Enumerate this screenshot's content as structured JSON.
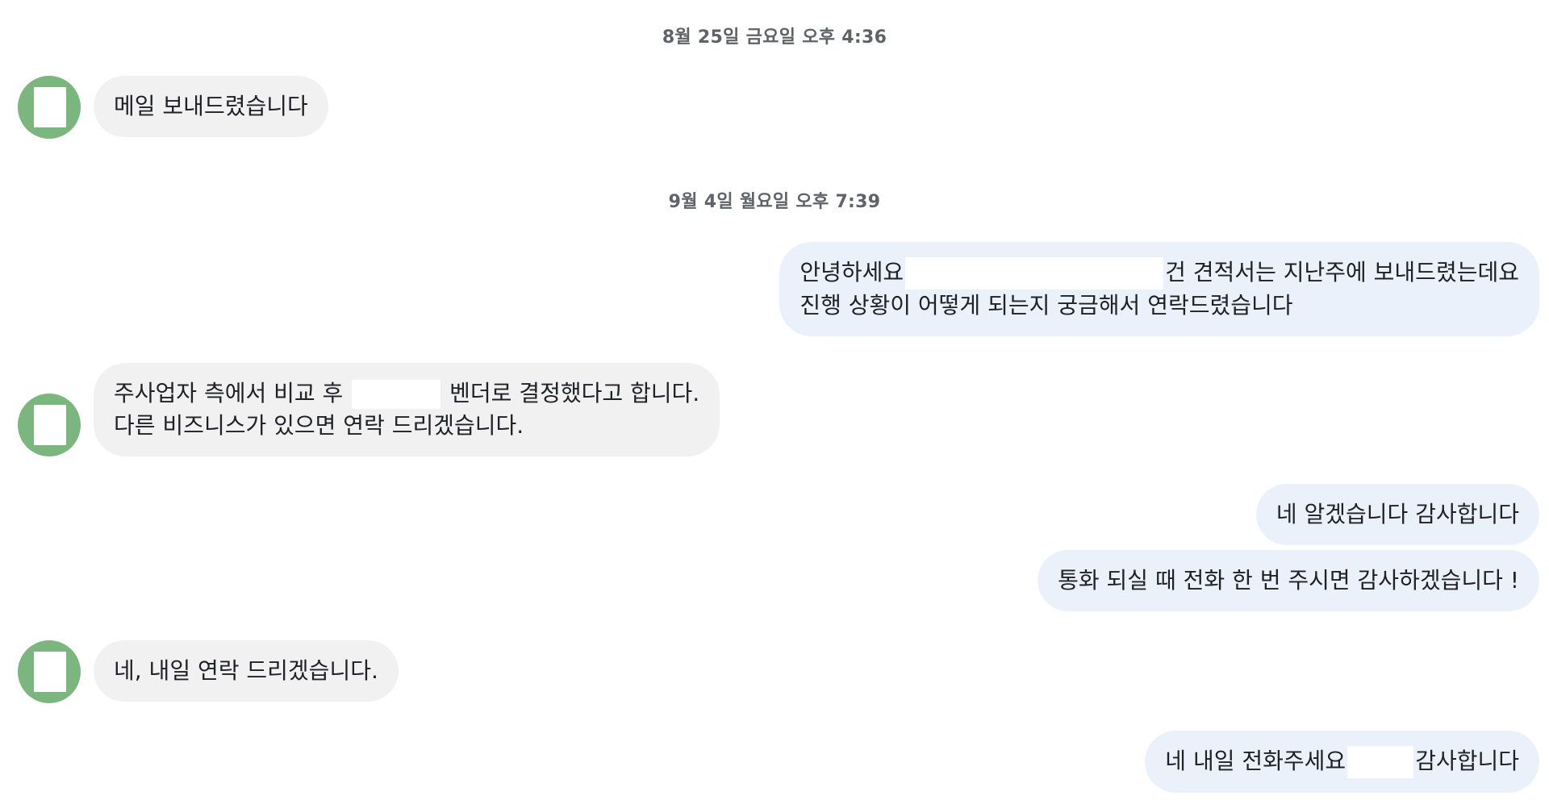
{
  "timestamps": [
    "8월 25일 금요일 오후 4:36",
    "9월 4일 월요일 오후 7:39"
  ],
  "messages": [
    {
      "line1": "메일 보내드렸습니다"
    },
    {
      "line1a": "안녕하세요",
      "line1b": "건 견적서는 지난주에 보내드렸는데요",
      "line2": "진행 상황이 어떻게 되는지 궁금해서 연락드렸습니다"
    },
    {
      "line1a": "주사업자 측에서 비교 후",
      "line1b": "벤더로 결정했다고 합니다.",
      "line2": "다른 비즈니스가 있으면 연락 드리겠습니다."
    },
    {
      "line1": "네 알겠습니다 감사합니다"
    },
    {
      "line1": "통화 되실 때 전화 한 번 주시면 감사하겠습니다 !"
    },
    {
      "line1": "네, 내일 연락 드리겠습니다."
    },
    {
      "line1a": "네 내일 전화주세요",
      "line1b": "감사합니다"
    }
  ],
  "colors": {
    "avatar": "#7cb67f",
    "incoming_bubble": "#f1f1f1",
    "outgoing_bubble": "#ebf1fb",
    "timestamp": "#5f6368"
  },
  "icons": {
    "avatar": "user-avatar-icon"
  }
}
